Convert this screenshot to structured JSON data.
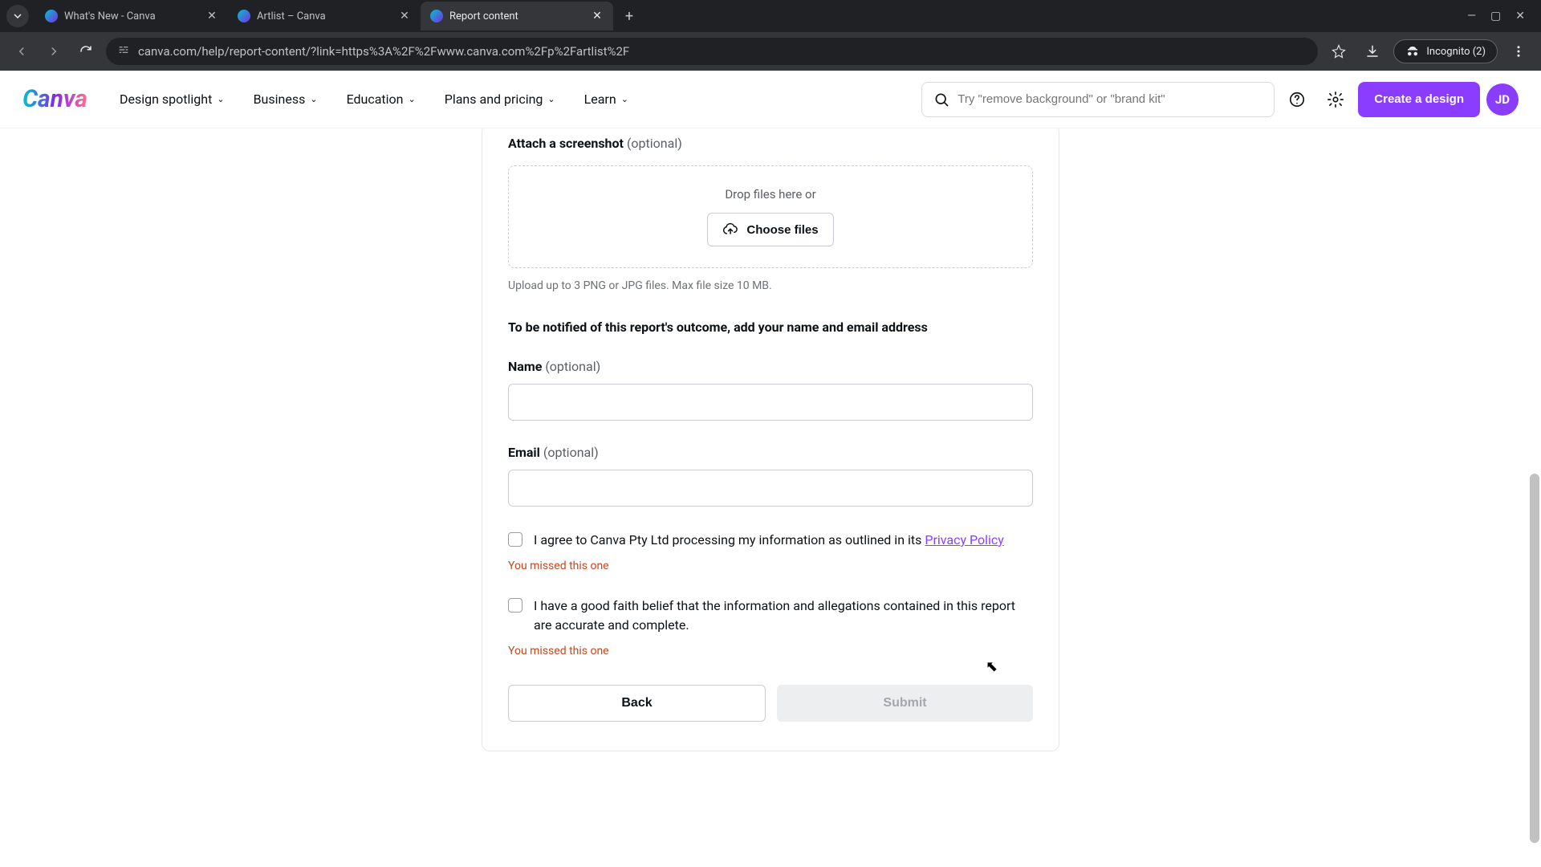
{
  "browser": {
    "tabs": [
      {
        "title": "What's New - Canva"
      },
      {
        "title": "Artlist – Canva"
      },
      {
        "title": "Report content"
      }
    ],
    "url": "canva.com/help/report-content/?link=https%3A%2F%2Fwww.canva.com%2Fp%2Fartlist%2F",
    "incognito": "Incognito (2)"
  },
  "header": {
    "logo": "Canva",
    "nav": {
      "design_spotlight": "Design spotlight",
      "business": "Business",
      "education": "Education",
      "plans": "Plans and pricing",
      "learn": "Learn"
    },
    "search_placeholder": "Try \"remove background\" or \"brand kit\"",
    "create": "Create a design",
    "avatar": "JD"
  },
  "form": {
    "attach_label": "Attach a screenshot",
    "optional": "(optional)",
    "drop_text": "Drop files here or",
    "choose_files": "Choose files",
    "upload_hint": "Upload up to 3 PNG or JPG files. Max file size 10 MB.",
    "notify_heading": "To be notified of this report's outcome, add your name and email address",
    "name_label": "Name",
    "email_label": "Email",
    "privacy_text": "I agree to Canva Pty Ltd processing my information as outlined in its ",
    "privacy_link": "Privacy Policy",
    "goodfaith_text": "I have a good faith belief that the information and allegations contained in this report are accurate and complete.",
    "error": "You missed this one",
    "back": "Back",
    "submit": "Submit"
  }
}
